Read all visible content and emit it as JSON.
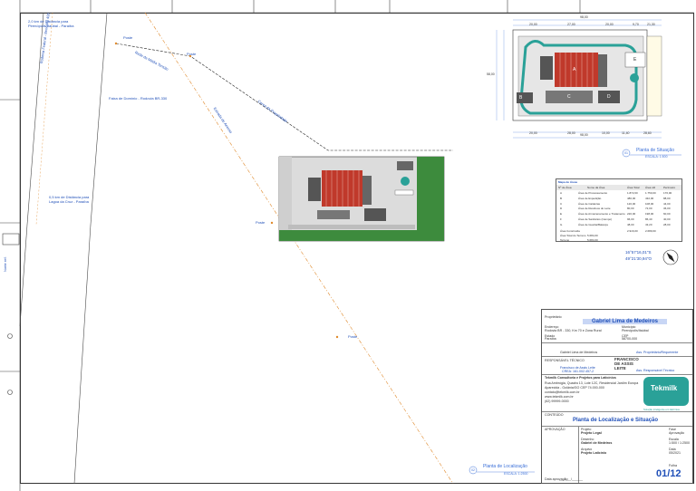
{
  "labels": {
    "dist_pirenopolis": "2,0 km de Distância para Pirenópolis Itaúbal - Paraíba",
    "rodovia_pe": "Rodovia Federal - Benedito 400",
    "poste_top": "Poste",
    "faixa_dominio": "Faixa de Domínio - Rodovia BR-330",
    "rede_media_tensao": "Rede de Média Tensão",
    "poste_right": "Poste",
    "cerca_propriedade": "Cerca da Propriedade",
    "estrada_acesso": "Estrada de Acesso",
    "dist_lagoa": "0,5 km de Distância para Lagoa da Cruz - Paraíba",
    "poste_mid": "Poste",
    "poste_bottom": "Poste",
    "norte_label": "Norte ref."
  },
  "situacao": {
    "number": "01",
    "title": "Planta de Situação",
    "scale": "ESCALA: 1:500"
  },
  "localizacao": {
    "number": "02",
    "title": "Planta de Localização",
    "scale": "ESCALA: 1:2500"
  },
  "site_dims": {
    "top_total": "98,00",
    "top_segments": [
      "20,00",
      "27,00",
      "20,00",
      "9,70",
      "21,30"
    ],
    "bottom_total": "98,00",
    "bottom_segments": [
      "20,00",
      "28,00",
      "10,00",
      "11,40",
      "28,60"
    ],
    "left_total": "58,00",
    "block_labels": [
      "A",
      "B",
      "C",
      "D",
      "E"
    ]
  },
  "area_table": {
    "title": "Mapa de Áreas",
    "headers": [
      "Nº de Área",
      "Nome da Área",
      "Área Total",
      "Área útil",
      "Perímetro"
    ],
    "rows": [
      [
        "A",
        "Área de Processamento",
        "1.872,00",
        "1.750,00",
        "176,00"
      ],
      [
        "B",
        "Área de Expedição",
        "480,00",
        "432,00",
        "88,00"
      ],
      [
        "C",
        "Área de Caldeiras",
        "120,00",
        "108,00",
        "44,00"
      ],
      [
        "D",
        "Área de Resíduos do Leite",
        "80,00",
        "72,00",
        "36,00"
      ],
      [
        "E",
        "Área de Armazenamento e Tratamento de Água e Esgoto",
        "220,00",
        "198,00",
        "60,00"
      ],
      [
        "F",
        "Área de Sanitários (Campo)",
        "96,00",
        "86,40",
        "40,00"
      ],
      [
        "G",
        "Área de Guarita/Balança",
        "48,00",
        "43,20",
        "28,00"
      ]
    ],
    "total_label": "Área Construída",
    "total_value": "2.916,00",
    "total_util": "2.689,60",
    "lot_label": "Área Total do Terreno",
    "lot_value": "5.684,00",
    "terreno_label": "Terreno",
    "terreno_value": "5.684,00"
  },
  "coords": {
    "lat": "16°57'16,01\"S",
    "lon": "49°21'30,94\"O"
  },
  "title_block": {
    "prop_label": "Proprietário",
    "owner": "Gabriel Lima de Medeiros",
    "address_label": "Endereço",
    "address": "Rodovia BR - 330, Km 70 e Zona Rural",
    "city_label": "Município",
    "city": "Pirenópolis/Itaúbal",
    "state_label": "Estado",
    "state": "Paraíba",
    "cep_label": "CEP",
    "cep": "58700-000",
    "owner_sig_label": "Gabriel Lima de Medeiros",
    "owner_role": "Ass. Proprietário/Requerente",
    "resp_label": "RESPONSÁVEL TÉCNICO",
    "resp_name": "Francisco de Assis Leite",
    "resp_crea": "CREA: 161.002.457-2",
    "resp_stamp": "FRANCISCO DE ASSIS LEITE",
    "resp_role": "Ass. Responsável Técnico",
    "company": "Tekmilk Consultoria e Projetos para Laticínios",
    "company_address": "Rua Ambrógia, Quadra 13, Lote 12C, Residencial Jardim Europa",
    "company_city": "Aparecida - Goiânia/GO  CEP 74.000-000",
    "company_email": "contato@tekmilk.com.br",
    "company_site": "www.tekmilk.com.br",
    "company_phone": "(62) 99999-0000",
    "logo_text": "Tekmilk",
    "logo_tagline": "Solução inteligente em laticínios",
    "content_label": "CONTEÚDO",
    "content": "Planta de Localização e Situação",
    "project_label": "Projeto",
    "project": "Projeto Legal",
    "phase_label": "Fase",
    "phase": "Aprovação",
    "drawn_label": "Desenho",
    "drawn": "Gabriel de Medeiros",
    "scale_label": "Escala",
    "scale": "1:500 / 1:2500",
    "file_label": "Arquivo",
    "file": "Projeto Laticínio",
    "date_label": "Data",
    "date": "05/2021",
    "sheet_label": "Folha",
    "sheet": "01/12",
    "approval_label": "APROVAÇÃO",
    "approval_date_label": "Data aprovação:",
    "approval_date": "___/___/______"
  },
  "colors": {
    "line_blue": "#1f4fb8",
    "grass": "#3d8b3d",
    "teal": "#2aa198",
    "roof_red": "#c0392b",
    "accent_orange": "#e08a2c"
  }
}
